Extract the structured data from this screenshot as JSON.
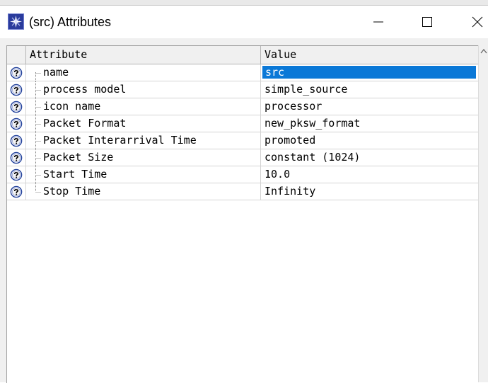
{
  "window": {
    "title": "(src) Attributes",
    "icon": "star-app-icon",
    "controls": [
      "minimize-icon",
      "maximize-icon",
      "close-icon"
    ]
  },
  "table": {
    "columns": [
      "Attribute",
      "Value"
    ],
    "selected_row": 0,
    "rows": [
      {
        "attribute": "name",
        "value": "src"
      },
      {
        "attribute": "process model",
        "value": "simple_source"
      },
      {
        "attribute": "icon name",
        "value": "processor"
      },
      {
        "attribute": "Packet Format",
        "value": "new_pksw_format"
      },
      {
        "attribute": "Packet Interarrival Time",
        "value": "promoted"
      },
      {
        "attribute": "Packet Size",
        "value": "constant (1024)"
      },
      {
        "attribute": "Start Time",
        "value": "10.0"
      },
      {
        "attribute": "Stop Time",
        "value": "Infinity"
      }
    ],
    "row_icon": "help-icon"
  },
  "colors": {
    "selection": "#0a78d7",
    "help_icon": "#1f3f9a"
  }
}
